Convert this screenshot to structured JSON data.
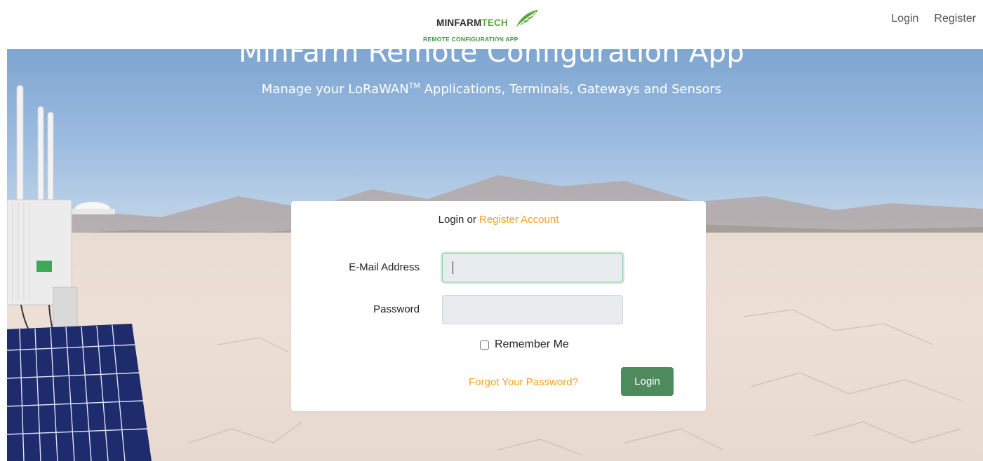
{
  "logo": {
    "brand_part1": "MINFARM",
    "brand_part2": "TECH",
    "subtitle": "REMOTE CONFIGURATION APP",
    "icon": "leaf-logo-icon"
  },
  "nav": {
    "login": "Login",
    "register": "Register"
  },
  "hero": {
    "title": "MinFarm Remote Configuration App",
    "subtitle_before": "Manage your LoRaWAN",
    "subtitle_tm": "TM",
    "subtitle_after": " Applications, Terminals, Gateways and Sensors"
  },
  "card": {
    "header_prefix": "Login or ",
    "header_link": "Register Account",
    "email_label": "E-Mail Address",
    "email_value": "",
    "password_label": "Password",
    "password_value": "",
    "remember_label": "Remember Me",
    "remember_checked": false,
    "forgot_label": "Forgot Your Password?",
    "login_button": "Login"
  },
  "colors": {
    "accent_orange": "#f5a01e",
    "button_green": "#4f8a5c",
    "brand_green": "#5aa63a"
  }
}
